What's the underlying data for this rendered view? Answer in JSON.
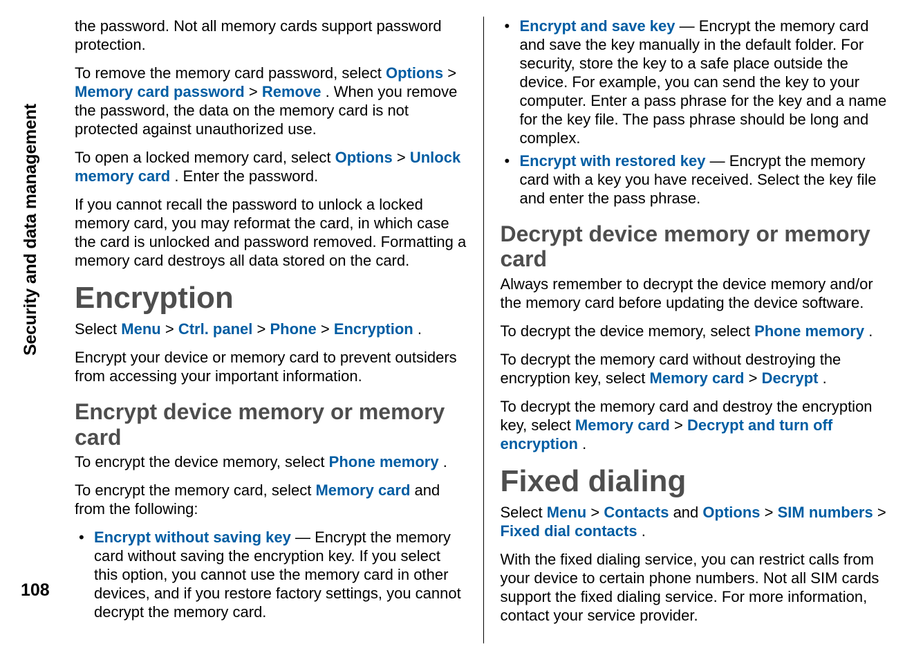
{
  "side_tab": "Security and data management",
  "page_number": "108",
  "left": {
    "p1": "the password. Not all memory cards support password protection.",
    "p2a": "To remove the memory card password, select ",
    "p2_options": "Options",
    "p2_sep1": " > ",
    "p2_mcp": "Memory card password",
    "p2_sep2": " > ",
    "p2_remove": "Remove",
    "p2b": ". When you remove the password, the data on the memory card is not protected against unauthorized use.",
    "p3a": "To open a locked memory card, select ",
    "p3_options": "Options",
    "p3_sep": " > ",
    "p3_link": "Unlock memory card",
    "p3b": ". Enter the password.",
    "p4": "If you cannot recall the password to unlock a locked memory card, you may reformat the card, in which case the card is unlocked and password removed. Formatting a memory card destroys all data stored on the card.",
    "h1": "Encryption",
    "p5a": "Select ",
    "p5_menu": "Menu",
    "p5_s1": " > ",
    "p5_ctrl": "Ctrl. panel",
    "p5_s2": " > ",
    "p5_phone": "Phone",
    "p5_s3": " > ",
    "p5_enc": "Encryption",
    "p5b": ".",
    "p6": "Encrypt your device or memory card to prevent outsiders from accessing your important information.",
    "h2": "Encrypt device memory or memory card",
    "p7a": "To encrypt the device memory, select ",
    "p7_link": "Phone memory",
    "p7b": ".",
    "p8a": "To encrypt the memory card, select ",
    "p8_link": "Memory card",
    "p8b": " and from the following:",
    "li1_link": "Encrypt without saving key",
    "li1_text": "  — Encrypt the memory card without saving the encryption key. If you select this option, you cannot use the memory card in other devices, and if you restore factory settings, you cannot decrypt the memory card."
  },
  "right": {
    "li2_link": "Encrypt and save key",
    "li2_text": "  — Encrypt the memory card and save the key manually in the default folder. For security, store the key to a safe place outside the device. For example, you can send the key to your computer. Enter a pass phrase for the key and a name for the key file. The pass phrase should be long and complex.",
    "li3_link": "Encrypt with restored key",
    "li3_text": "  — Encrypt the memory card with a key you have received. Select the key file and enter the pass phrase.",
    "h2a": "Decrypt device memory or memory card",
    "p1": "Always remember to decrypt the device memory and/or the memory card before updating the device software.",
    "p2a": "To decrypt the device memory, select ",
    "p2_link": "Phone memory",
    "p2b": ".",
    "p3a": "To decrypt the memory card without destroying the encryption key, select ",
    "p3_link1": "Memory card",
    "p3_sep": " > ",
    "p3_link2": "Decrypt",
    "p3b": ".",
    "p4a": "To decrypt the memory card and destroy the encryption key, select ",
    "p4_link1": "Memory card",
    "p4_sep": " > ",
    "p4_link2": "Decrypt and turn off encryption",
    "p4b": ".",
    "h1b": "Fixed dialing",
    "p5a": "Select ",
    "p5_menu": "Menu",
    "p5_s1": " > ",
    "p5_contacts": "Contacts",
    "p5_and": " and ",
    "p5_options": "Options",
    "p5_s2": " > ",
    "p5_sim": "SIM numbers",
    "p5_s3": " > ",
    "p5_fdc": "Fixed dial contacts",
    "p5b": ".",
    "p6": "With the fixed dialing service, you can restrict calls from your device to certain phone numbers. Not all SIM cards support the fixed dialing service. For more information, contact your service provider."
  }
}
